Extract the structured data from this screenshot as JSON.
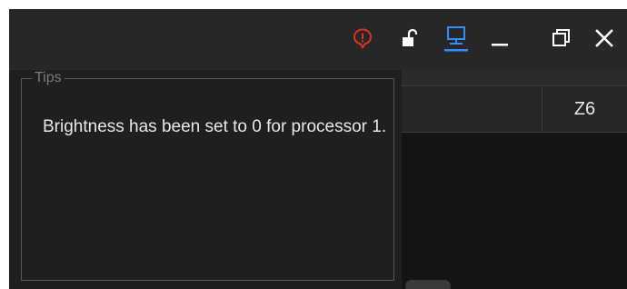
{
  "titlebar": {
    "icons": [
      {
        "name": "alert-icon",
        "color": "#e0302a"
      },
      {
        "name": "unlock-icon",
        "color": "#ffffff"
      },
      {
        "name": "monitor-icon",
        "color": "#2f8fff"
      },
      {
        "name": "minimize-icon",
        "color": "#ffffff"
      },
      {
        "name": "restore-icon",
        "color": "#ffffff"
      },
      {
        "name": "close-icon",
        "color": "#ffffff"
      }
    ]
  },
  "table": {
    "header_cell": "Z6"
  },
  "tips": {
    "legend": "Tips",
    "message": "Brightness has been set to 0 for processor 1."
  }
}
